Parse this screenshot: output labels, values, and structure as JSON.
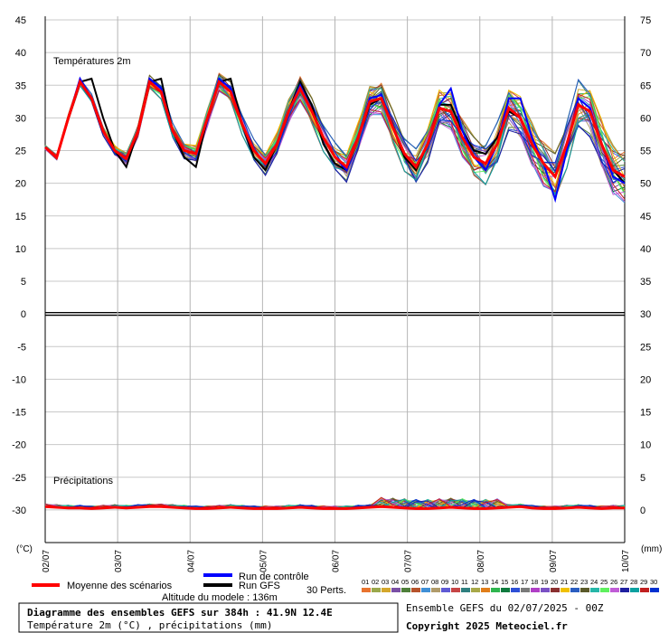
{
  "chart_data": {
    "type": "line",
    "x": [
      "02/07",
      "03/07",
      "04/07",
      "05/07",
      "06/07",
      "07/07",
      "08/07",
      "09/07",
      "10/07"
    ],
    "ylim_left": [
      -35,
      45
    ],
    "ylim_right_precip": [
      -5,
      75
    ],
    "left_ticks": [
      45,
      40,
      35,
      30,
      25,
      20,
      15,
      10,
      5,
      0,
      -5,
      -10,
      -15,
      -20,
      -25,
      -30
    ],
    "right_ticks": [
      75,
      70,
      65,
      60,
      55,
      50,
      45,
      40,
      35,
      30,
      25,
      20,
      15,
      10,
      5,
      0
    ],
    "left_unit": "(°C)",
    "right_unit": "(mm)",
    "temp_title": "Températures 2m",
    "precip_title": "Précipitations",
    "series": [
      {
        "name": "Moyenne des scénarios",
        "color": "#ff0000",
        "values": [
          25.5,
          24,
          30,
          35.5,
          33,
          28,
          25,
          23.8,
          28,
          35.5,
          34,
          28,
          25,
          24.5,
          30,
          35.5,
          34,
          29,
          25,
          23,
          26,
          31,
          34.5,
          31,
          27,
          24,
          22.5,
          27,
          32.5,
          33,
          28.5,
          24.5,
          22.5,
          26,
          31.5,
          31,
          27,
          24,
          23,
          26,
          31.5,
          30,
          26,
          23,
          21,
          26,
          32,
          31,
          26,
          22,
          21
        ]
      },
      {
        "name": "Run de contrôle",
        "color": "#0000ff",
        "values": [
          25.5,
          24,
          30,
          36,
          33,
          28,
          25,
          24,
          28,
          36,
          34.5,
          28,
          25,
          24.5,
          30,
          36,
          34.5,
          29,
          25,
          23,
          26,
          31,
          35,
          31,
          27,
          24,
          22,
          27,
          33,
          33.5,
          28.5,
          24.5,
          22.5,
          26,
          32,
          34.5,
          28,
          24,
          22,
          26,
          33,
          33,
          27,
          23,
          17.5,
          25,
          33,
          31.5,
          26,
          21,
          20
        ]
      },
      {
        "name": "Run GFS",
        "color": "#000000",
        "values": [
          25.5,
          24,
          30,
          35.5,
          36,
          30,
          25,
          22.5,
          28,
          35.5,
          36,
          28,
          24,
          22.5,
          30,
          35.5,
          36,
          29,
          24,
          22,
          26,
          31,
          35.5,
          32,
          26,
          23,
          22,
          27,
          32,
          33,
          28.5,
          24,
          22,
          26,
          32,
          32,
          28,
          25,
          24.5,
          27,
          31,
          30,
          26,
          23,
          21,
          26,
          32,
          31,
          26,
          22,
          20
        ]
      }
    ],
    "precip_series": [
      {
        "name": "Moyenne des scénarios",
        "color": "#ff0000",
        "values": [
          0.5,
          0.4,
          0.3,
          0.3,
          0.2,
          0.3,
          0.4,
          0.3,
          0.4,
          0.5,
          0.5,
          0.4,
          0.3,
          0.2,
          0.2,
          0.3,
          0.4,
          0.3,
          0.2,
          0.2,
          0.2,
          0.3,
          0.4,
          0.3,
          0.2,
          0.2,
          0.2,
          0.3,
          0.4,
          0.5,
          0.4,
          0.3,
          0.2,
          0.2,
          0.3,
          0.4,
          0.3,
          0.2,
          0.2,
          0.3,
          0.4,
          0.5,
          0.3,
          0.2,
          0.2,
          0.3,
          0.4,
          0.3,
          0.2,
          0.3,
          0.3
        ]
      }
    ]
  },
  "legend": {
    "mean_label": "Moyenne des scénarios",
    "control_label": "Run de contrôle",
    "gfs_label": "Run GFS",
    "perts_label": "30 Perts.",
    "pert_numbers": [
      "01",
      "02",
      "03",
      "04",
      "05",
      "06",
      "07",
      "08",
      "09",
      "10",
      "11",
      "12",
      "13",
      "14",
      "15",
      "16",
      "17",
      "18",
      "19",
      "20",
      "21",
      "22",
      "23",
      "24",
      "25",
      "26",
      "27",
      "28",
      "29",
      "30"
    ],
    "pert_colors": [
      "#e8732e",
      "#9aa84b",
      "#d4a72c",
      "#7a4fa5",
      "#4e7f3a",
      "#b6532c",
      "#3f8fd6",
      "#b09b6b",
      "#5e5ad4",
      "#c64545",
      "#2e7f7f",
      "#a8a848",
      "#e07d1a",
      "#2fb54f",
      "#0e7a3e",
      "#2d4fd6",
      "#7a7a7a",
      "#b03fc6",
      "#7a50c4",
      "#8a3030",
      "#f0c000",
      "#2a5dc0",
      "#5a5a2a",
      "#26b6a8",
      "#5ef05e",
      "#c05cd6",
      "#1f1fa0",
      "#0aa0a0",
      "#c02020",
      "#0030d0"
    ],
    "altitude": "Altitude du modele : 136m"
  },
  "footer": {
    "title": "Diagramme des ensembles GEFS sur 384h : 41.9N 12.4E",
    "subtitle": "Température 2m (°C) , précipitations (mm)",
    "run": "Ensemble GEFS du 02/07/2025 - 00Z",
    "copyright": "Copyright 2025 Meteociel.fr"
  }
}
